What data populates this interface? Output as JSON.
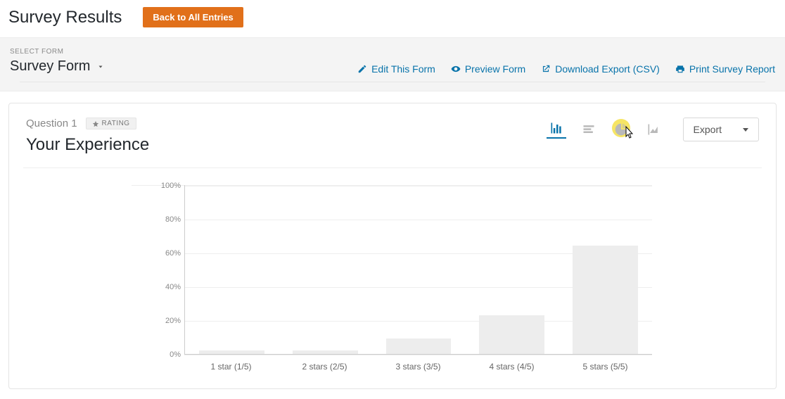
{
  "header": {
    "title": "Survey Results",
    "back_button": "Back to All Entries"
  },
  "subbar": {
    "select_form_label": "SELECT FORM",
    "form_name": "Survey Form",
    "actions": {
      "edit": "Edit This Form",
      "preview": "Preview Form",
      "download": "Download Export (CSV)",
      "print": "Print Survey Report"
    }
  },
  "card": {
    "question_label": "Question 1",
    "badge": "RATING",
    "title": "Your Experience",
    "export_label": "Export"
  },
  "chart_data": {
    "type": "bar",
    "categories": [
      "1 star (1/5)",
      "2 stars (2/5)",
      "3 stars (3/5)",
      "4 stars (4/5)",
      "5 stars (5/5)"
    ],
    "values": [
      2,
      2,
      9,
      23,
      64
    ],
    "title": "Your Experience",
    "xlabel": "",
    "ylabel": "",
    "ylim": [
      0,
      100
    ],
    "y_ticks": [
      0,
      20,
      40,
      60,
      80,
      100
    ],
    "y_tick_labels": [
      "0%",
      "20%",
      "40%",
      "60%",
      "80%",
      "100%"
    ]
  }
}
